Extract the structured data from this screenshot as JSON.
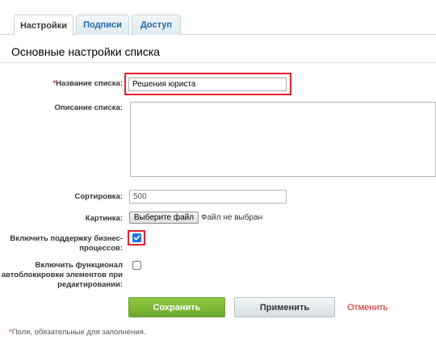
{
  "tabs": [
    {
      "label": "Настройки"
    },
    {
      "label": "Подписи"
    },
    {
      "label": "Доступ"
    }
  ],
  "section": {
    "title": "Основные настройки списка"
  },
  "form": {
    "name_required_mark": "*",
    "name_label": "Название списка:",
    "name_value": "Решения юриста",
    "description_label": "Описание списка:",
    "description_value": "",
    "sort_label": "Сортировка:",
    "sort_value": "500",
    "picture_label": "Картинка:",
    "file_button_label": "Выберите файл",
    "file_status": "Файл не выбран",
    "bp_label_line1": "Включить поддержку бизнес-",
    "bp_label_line2": "процессов:",
    "bp_checked": true,
    "autolock_label_line1": "Включить функционал",
    "autolock_label_line2": "автоблокировки элементов при",
    "autolock_label_line3": "редактировании:",
    "autolock_checked": false
  },
  "buttons": {
    "save": "Сохранить",
    "apply": "Применить",
    "cancel": "Отменить"
  },
  "footnote": {
    "mark": "*",
    "text": "Поля, обязательные для заполнения."
  },
  "colors": {
    "highlight": "#e8202a",
    "save_button": "#7cb935",
    "cancel_link": "#d81b1b",
    "checkbox": "#1a73e8"
  }
}
